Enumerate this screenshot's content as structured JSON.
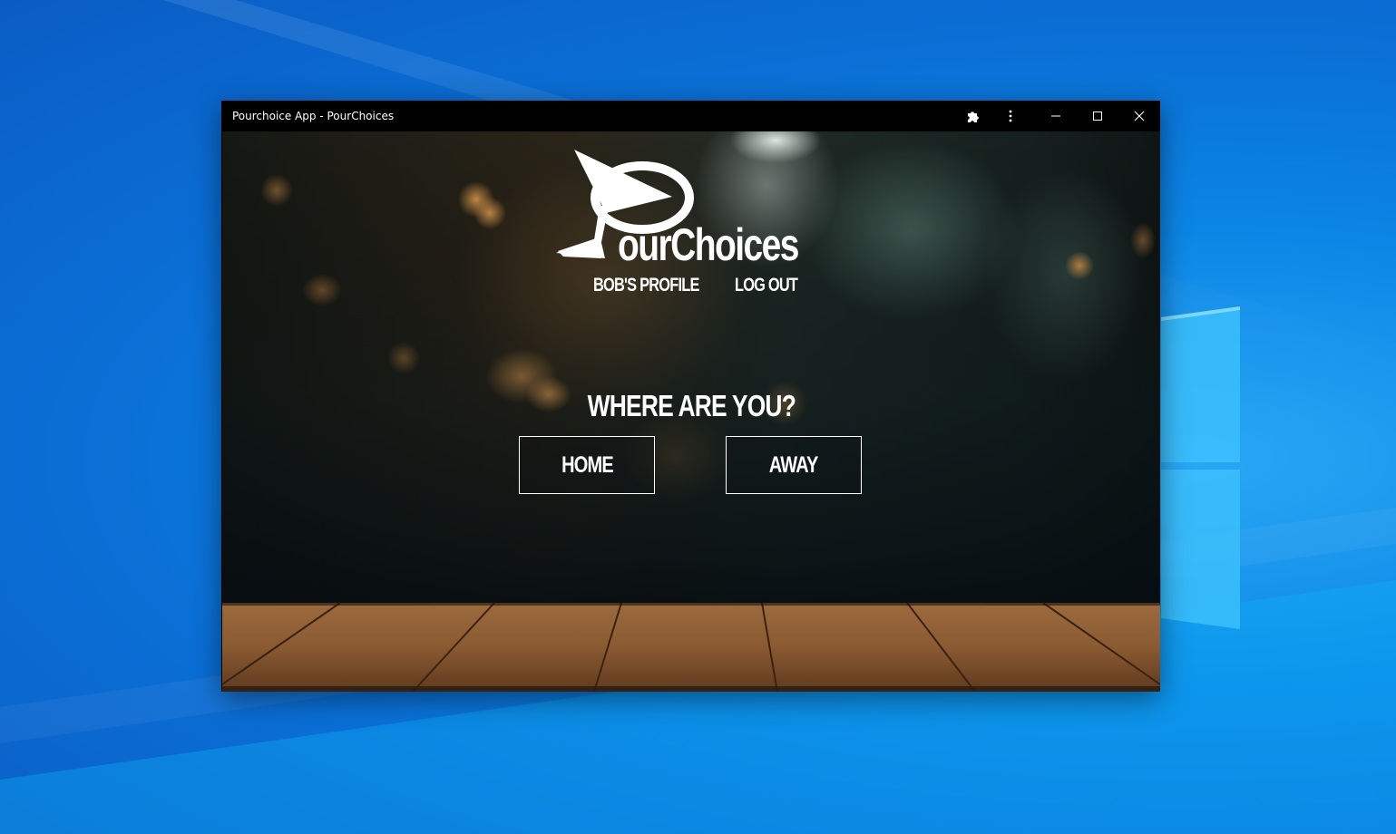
{
  "window": {
    "title": "Pourchoice App - PourChoices",
    "extensions_icon": "puzzle-piece-icon",
    "menu_icon": "vertical-ellipsis-icon",
    "minimize_icon": "minimize-icon",
    "maximize_icon": "maximize-icon",
    "close_icon": "close-icon"
  },
  "brand": {
    "logo_icon": "martini-glass-icon",
    "name": "ourChoices"
  },
  "nav": {
    "profile": "BOB'S PROFILE",
    "logout": "LOG OUT"
  },
  "location": {
    "question": "WHERE ARE YOU?",
    "home": "HOME",
    "away": "AWAY"
  },
  "colors": {
    "desktop_blue": "#0a78dc",
    "titlebar": "#000000",
    "text": "#ffffff",
    "table_wood": "#8a5a34"
  }
}
